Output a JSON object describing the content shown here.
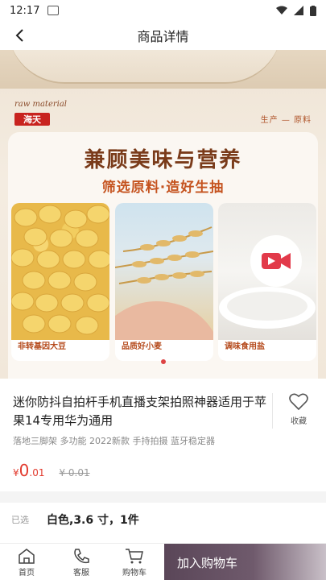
{
  "status_bar": {
    "time": "12:17"
  },
  "nav": {
    "title": "商品详情"
  },
  "hero": {
    "raw_material": "raw material",
    "brand": "海天",
    "section_tag": "生产 — 原料",
    "headline": "兼顾美味与营养",
    "subline": "筛选原料·造好生抽",
    "tiles": [
      {
        "label": "非转基因大豆"
      },
      {
        "label": "品质好小麦"
      },
      {
        "label": "调味食用盐"
      }
    ]
  },
  "product": {
    "title": "迷你防抖自拍杆手机直播支架拍照神器适用于苹果14专用华为通用",
    "tags": "落地三脚架 多功能 2022新款 手持拍摄 蓝牙稳定器",
    "price": {
      "symbol": "¥",
      "integer": "0",
      "decimal": ".01"
    },
    "original_price": "¥ 0.01",
    "favorite_label": "收藏"
  },
  "selected": {
    "label": "已选",
    "value": "白色,3.6 寸，1件"
  },
  "bottom_bar": {
    "home": "首页",
    "service": "客服",
    "cart": "购物车",
    "add_to_cart": "加入购物车"
  },
  "colors": {
    "price": "#e23a2e",
    "brand_red": "#c8231f",
    "headline": "#7a3b1a",
    "cart_button": "#5a4658"
  }
}
